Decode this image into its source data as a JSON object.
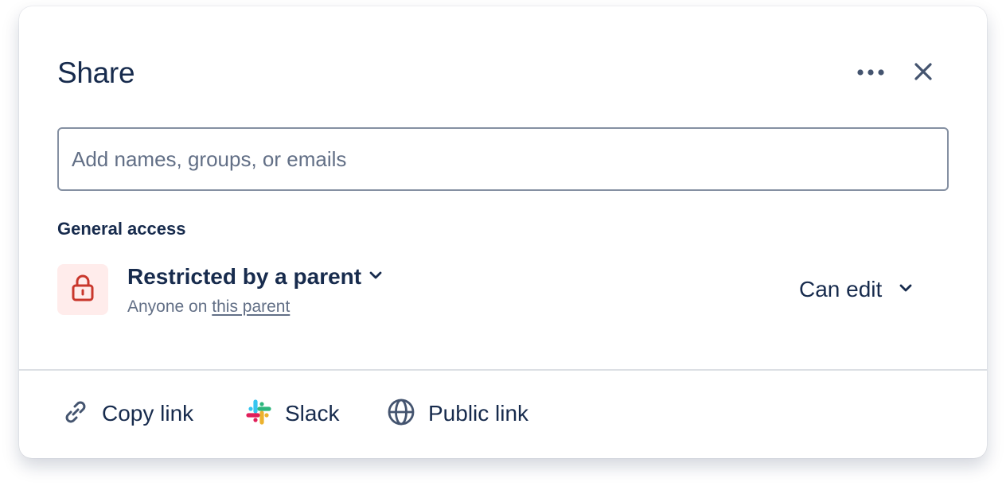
{
  "dialog": {
    "title": "Share",
    "more_icon": "more-horizontal-icon",
    "close_icon": "close-icon"
  },
  "search": {
    "placeholder": "Add names, groups, or emails",
    "value": ""
  },
  "general_access": {
    "label": "General access",
    "lock_icon": "lock-icon",
    "lock_color": "#c9372c",
    "lock_bg": "#ffeceb",
    "title": "Restricted by a parent",
    "subtitle_prefix": "Anyone on ",
    "subtitle_link": "this parent",
    "permission": "Can edit"
  },
  "footer": {
    "copy_link": "Copy link",
    "slack": "Slack",
    "public_link": "Public link"
  },
  "colors": {
    "text": "#172b4d",
    "subtle": "#626f86",
    "border": "#8590a2",
    "divider": "#dcdfe4"
  }
}
